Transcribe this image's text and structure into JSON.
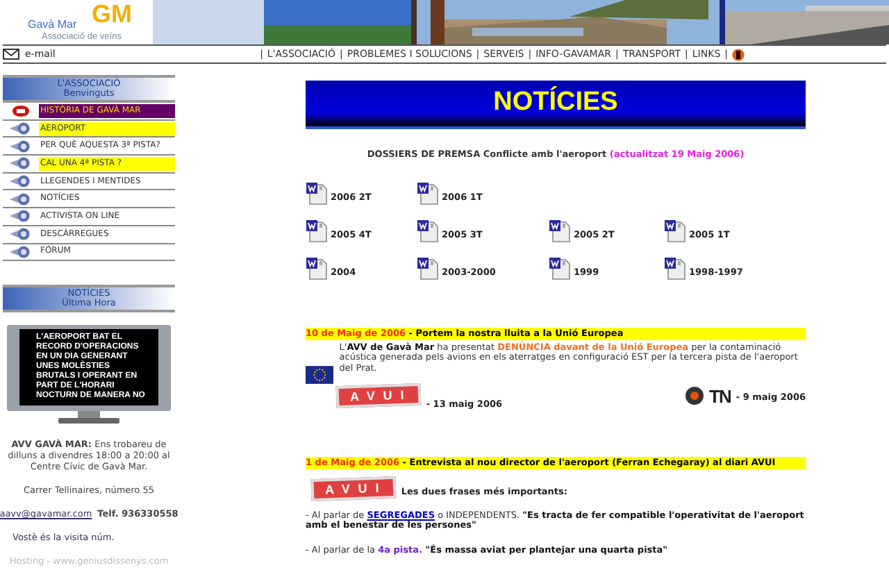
{
  "header": {
    "logo_name": "Gavà Mar",
    "logo_mark": "GM",
    "logo_tagline": "Associació de veïns",
    "email": "e-mail",
    "nav_separator": "|",
    "nav": [
      "L'ASSOCIACIÓ",
      "PROBLEMES I SOLUCIONS",
      "SERVEIS",
      "INFO-GAVAMAR",
      "TRANSPORT",
      "LINKS"
    ]
  },
  "sidebar": {
    "header": [
      "L'ASSOCIACIÓ",
      "Benvinguts"
    ],
    "items": [
      {
        "label": "HISTÒRIA DE GAVÀ MAR",
        "kind": "new",
        "color": "#660066"
      },
      {
        "label": "AEROPORT",
        "kind": "plain",
        "color": "#ffff00"
      },
      {
        "label": "PER QUÈ AQUESTA 3ª PISTA?",
        "kind": "plain"
      },
      {
        "label": "CAL UNA 4ª PISTA ?",
        "kind": "plain",
        "color": "#ffff00"
      },
      {
        "label": "LLEGENDES I MENTIDES",
        "kind": "plain"
      },
      {
        "label": "NOTÍCIES",
        "kind": "plain"
      },
      {
        "label": "ACTIVISTA ON LINE",
        "kind": "plain"
      },
      {
        "label": "DESCÀRREGUES",
        "kind": "plain"
      },
      {
        "label": "FÒRUM",
        "kind": "plain"
      }
    ]
  },
  "news_box": {
    "header": [
      "NOTÍCIES",
      "Última Hora"
    ],
    "ticker": [
      "L'AEROPORT BAT EL",
      "RECORD D'OPERACIONS",
      "EN UN DIA GENERANT",
      "UNES MOLÈSTIES",
      "BRUTALS I OPERANT EN",
      "PART DE L'HORARI",
      "NOCTURN DE MANERA NO"
    ]
  },
  "contact": {
    "hours": "**AVV GAVÀ MAR:** Ens trobareu de dilluns a divendres 18:00 a 20:00 al Centre Cívic de Gavà Mar.",
    "address": "Carrer Tellinaires, número 55",
    "email": "aavv@gavamar.com",
    "phone": "Telf. 936330558",
    "visits": "Vostè és la visita núm.",
    "hosting": "Hosting - www.geniusdissenys.com"
  },
  "main": {
    "title": "NOTÍCIES",
    "dossier": {
      "title": "DOSSIERS DE PREMSA Conflicte amb l'aeroport",
      "updated": "(actualitzat 19 Maig 2006)",
      "rows": [
        [
          "2006 2T",
          "2006 1T"
        ],
        [
          "2005 4T",
          "2005 3T",
          "2005 2T",
          "2005 1T"
        ],
        [
          "2004",
          "2003-2000",
          "1999",
          "1998-1997"
        ]
      ]
    },
    "news": [
      {
        "date": "10 de Maig de 2006",
        "headline": " - Portem la nostra lluita a la Unió Europea",
        "flag": true,
        "body": [
          {
            "kind": "text",
            "text": "L'"
          },
          {
            "kind": "bold",
            "text": "AVV de Gavà Mar"
          },
          {
            "kind": "text",
            "text": " ha presentat "
          },
          {
            "kind": "alert",
            "text": "DENÚNCIA davant de la Unió Europea"
          },
          {
            "kind": "text",
            "text": " per la contaminació acústica generada pels avions en els aterratges en configuració EST per la tercera pista de l'aeroport del Prat."
          }
        ],
        "press": [
          {
            "kind": "avui",
            "logo": "AVUI",
            "date": "- 13 maig 2006"
          },
          {
            "kind": "tn",
            "logo": "TN",
            "date": "- 9 maig 2006"
          }
        ]
      },
      {
        "date": "1 de Maig de 2006",
        "headline": " - Entrevista al nou director de l'aeroport (Ferran Echegaray) al diari AVUI",
        "press": [
          {
            "kind": "avui",
            "logo": "AVUI",
            "date": "Les dues frases més importants:"
          }
        ],
        "quotes": [
          [
            {
              "kind": "text",
              "text": "- Al parlar de "
            },
            {
              "kind": "link",
              "text": "SEGREGADES"
            },
            {
              "kind": "text",
              "text": " o INDEPENDENTS. "
            },
            {
              "kind": "bold",
              "text": "\"Es tracta de fer compatible l'operativitat de l'aeroport amb el benestar de les persones\""
            }
          ],
          [
            {
              "kind": "text",
              "text": "- Al parlar de la "
            },
            {
              "kind": "accent",
              "text": "4a pista. "
            },
            {
              "kind": "bold",
              "text": "\"És massa aviat per plantejar una quarta pista\""
            }
          ]
        ]
      }
    ]
  }
}
